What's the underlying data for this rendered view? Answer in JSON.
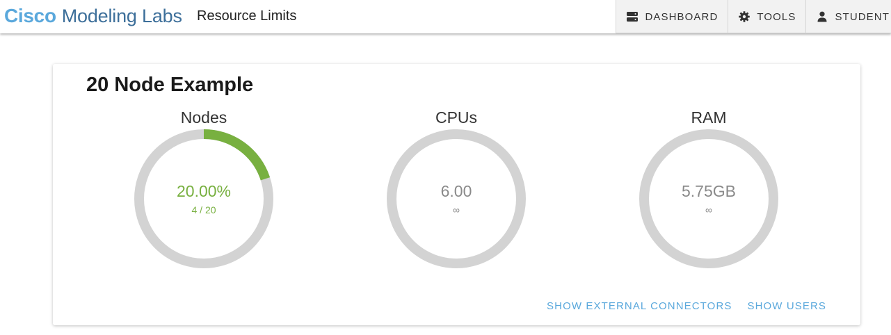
{
  "header": {
    "brand_primary": "Cisco",
    "brand_secondary": "Modeling Labs",
    "page_title": "Resource Limits",
    "brand_colors": {
      "cisco": "#5aa8dc",
      "rest": "#3d6f9a"
    }
  },
  "nav": {
    "items": [
      {
        "label": "DASHBOARD",
        "icon": "dashboard-icon"
      },
      {
        "label": "TOOLS",
        "icon": "gear-icon"
      },
      {
        "label": "STUDENT",
        "icon": "user-icon"
      }
    ]
  },
  "card": {
    "title": "20 Node Example",
    "gauges": [
      {
        "label": "Nodes",
        "value": "20.00%",
        "sub": "4 / 20",
        "fraction": 0.2,
        "color": "#78b040"
      },
      {
        "label": "CPUs",
        "value": "6.00",
        "sub": "∞",
        "fraction": 0,
        "color": "#8a8a8a"
      },
      {
        "label": "RAM",
        "value": "5.75GB",
        "sub": "∞",
        "fraction": 0,
        "color": "#8a8a8a"
      }
    ],
    "actions": {
      "show_external_connectors": "SHOW EXTERNAL CONNECTORS",
      "show_users": "SHOW USERS"
    }
  },
  "colors": {
    "track": "#d3d3d3",
    "accent": "#78b040",
    "link": "#5aa8dc"
  }
}
